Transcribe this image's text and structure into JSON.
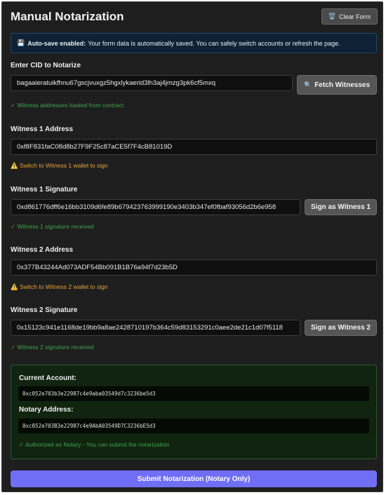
{
  "header": {
    "title": "Manual Notarization",
    "clear_icon": "trash-icon",
    "clear_label": "Clear Form"
  },
  "banner": {
    "icon": "floppy-disk-icon",
    "bold_text": "Auto-save enabled:",
    "text": "Your form data is automatically saved. You can safely switch accounts or refresh the page."
  },
  "cid": {
    "label": "Enter CID to Notarize",
    "value": "bagaaieratuikfhnu67gscjvuxgz5hgxlykaerid3lh3aj4jmzg3pk6cf5mxq",
    "fetch_icon": "magnifier-icon",
    "fetch_label": "Fetch Witnesses",
    "status": "✓ Witness addresses loaded from contract"
  },
  "witness1": {
    "address_label": "Witness 1 Address",
    "address_value": "0xf8F831faC08d8b27F9F25c87aCE5f7F4cB81019D",
    "warning": "⚠️ Switch to Witness 1 wallet to sign",
    "signature_label": "Witness 1 Signature",
    "signature_value": "0xd861776dff6e16bb3109d6fe89b679423763999190e3403b347ef0fbaf93056d2b6e958",
    "sign_label": "Sign as Witness 1",
    "signature_status": "✓ Witness 1 signature received"
  },
  "witness2": {
    "address_label": "Witness 2 Address",
    "address_value": "0x377B43244Ad073ADF54Bb091B1B76a94f7d23b5D",
    "warning": "⚠️ Switch to Witness 2 wallet to sign",
    "signature_label": "Witness 2 Signature",
    "signature_value": "0x15123c941e1168de19bb9a8ae2428710197b364c59d83153291c0aee2de21c1d07f5118",
    "sign_label": "Sign as Witness 2",
    "signature_status": "✓ Witness 2 signature received"
  },
  "account": {
    "current_label": "Current Account:",
    "current_value": "0xc052e703b3e22987c4e9aba03549d7c3236be5d3",
    "notary_label": "Notary Address:",
    "notary_value": "0xc052e703B3e22987c4e9AbA03549D7C3236bE5d3",
    "status": "✓ Authorized as Notary - You can submit the notarization"
  },
  "submit": {
    "label": "Submit Notarization (Notary Only)"
  },
  "colors": {
    "accent": "#6f6ef5",
    "success": "#3fa34d",
    "warning": "#e8a23a"
  }
}
